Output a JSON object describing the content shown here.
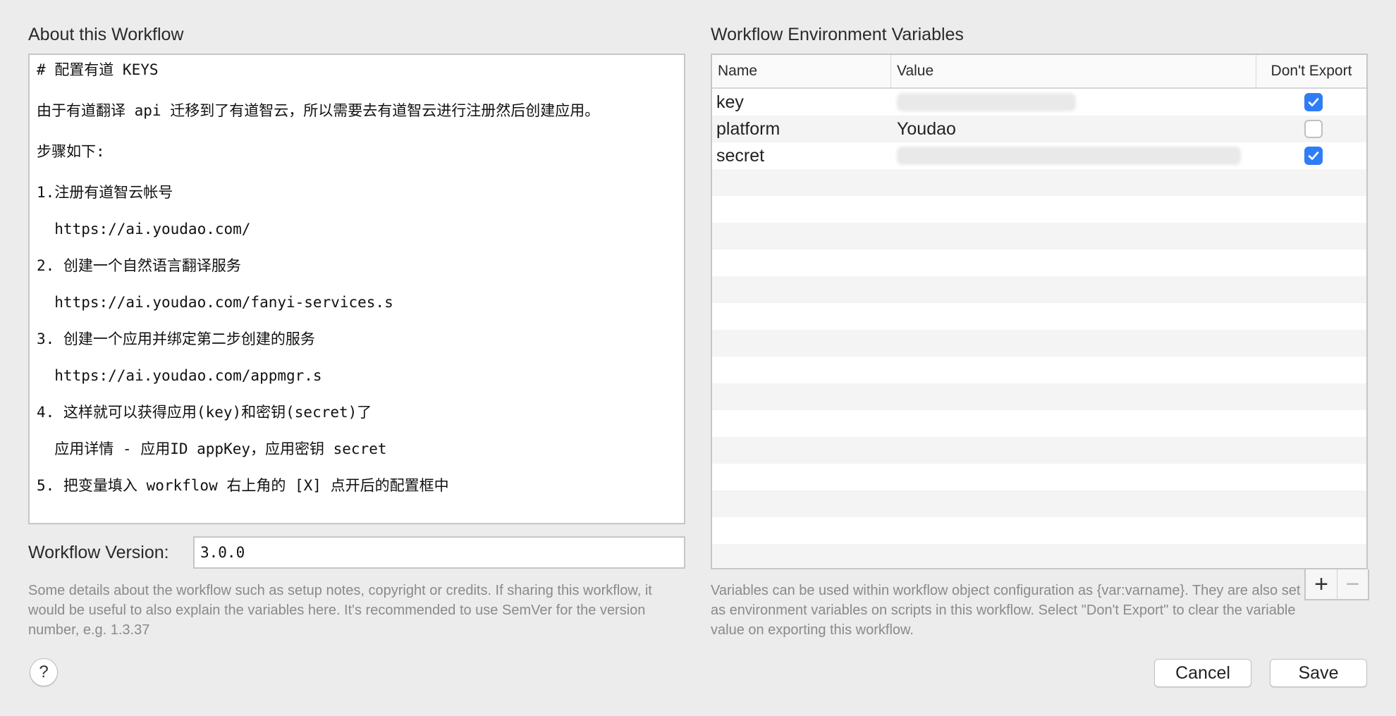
{
  "about": {
    "title": "About this Workflow",
    "notes": [
      "# 配置有道 KEYS",
      "由于有道翻译 api 迁移到了有道智云，所以需要去有道智云进行注册然后创建应用。",
      "步骤如下:",
      "1.注册有道智云帐号",
      "  https://ai.youdao.com/",
      "2. 创建一个自然语言翻译服务",
      "  https://ai.youdao.com/fanyi-services.s",
      "3. 创建一个应用并绑定第二步创建的服务",
      "  https://ai.youdao.com/appmgr.s",
      "4. 这样就可以获得应用(key)和密钥(secret)了",
      "  应用详情 - 应用ID appKey，应用密钥 secret",
      "5. 把变量填入 workflow 右上角的 [X] 点开后的配置框中"
    ],
    "version_label": "Workflow Version:",
    "version_value": "3.0.0",
    "help": "Some details about the workflow such as setup notes, copyright or credits. If sharing this workflow, it would be useful to also explain the variables here. It's recommended to use SemVer for the version number, e.g. 1.3.37"
  },
  "env": {
    "title": "Workflow Environment Variables",
    "columns": {
      "name": "Name",
      "value": "Value",
      "dont_export": "Don't Export"
    },
    "rows": [
      {
        "name": "key",
        "value": "",
        "blurred": true,
        "dont_export": true
      },
      {
        "name": "platform",
        "value": "Youdao",
        "blurred": false,
        "dont_export": false
      },
      {
        "name": "secret",
        "value": "",
        "blurred": true,
        "dont_export": true
      }
    ],
    "add_label": "+",
    "remove_label": "−",
    "help": "Variables can be used within workflow object configuration as {var:varname}. They are also set as environment variables on scripts in this workflow. Select \"Don't Export\" to clear the variable value on exporting this workflow."
  },
  "buttons": {
    "help": "?",
    "cancel": "Cancel",
    "save": "Save"
  },
  "colors": {
    "checkbox_accent": "#2f7df6",
    "background": "#ececec"
  }
}
